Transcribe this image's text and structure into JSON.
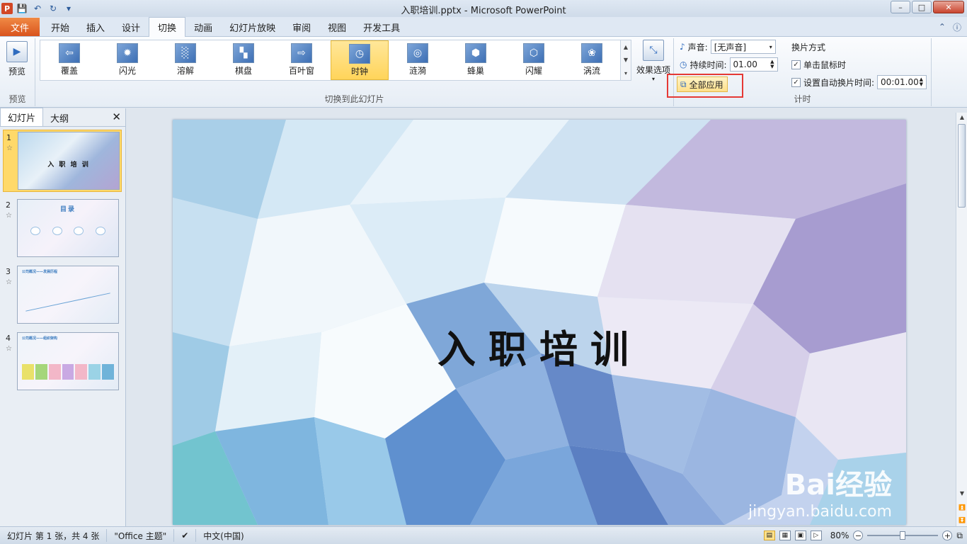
{
  "window": {
    "title": "入职培训.pptx - Microsoft PowerPoint",
    "app_icon": "P",
    "controls": [
      "minimize-icon",
      "maximize-icon",
      "close-icon"
    ]
  },
  "quick_access": [
    "save-icon",
    "undo-icon",
    "redo-icon",
    "customize-icon"
  ],
  "ribbon_tabs": {
    "file": "文件",
    "items": [
      "开始",
      "插入",
      "设计",
      "切换",
      "动画",
      "幻灯片放映",
      "审阅",
      "视图",
      "开发工具"
    ],
    "active": "切换"
  },
  "ribbon": {
    "preview": {
      "label": "预览",
      "group_label": "预览"
    },
    "transitions": [
      "覆盖",
      "闪光",
      "溶解",
      "棋盘",
      "百叶窗",
      "时钟",
      "涟漪",
      "蜂巢",
      "闪耀",
      "涡流"
    ],
    "selected_transition": "时钟",
    "group_label": "切换到此幻灯片",
    "effect_options": "效果选项",
    "timing": {
      "sound_label": "声音:",
      "sound_value": "[无声音]",
      "duration_label": "持续时间:",
      "duration_value": "01.00",
      "apply_all": "全部应用",
      "advance_title": "换片方式",
      "on_click_label": "单击鼠标时",
      "on_click_checked": true,
      "auto_after_label": "设置自动换片时间:",
      "auto_after_checked": true,
      "auto_after_value": "00:01.00",
      "group_label": "计时"
    }
  },
  "left_panel": {
    "tabs": [
      "幻灯片",
      "大纲"
    ],
    "active_tab": "幻灯片",
    "slides": [
      {
        "number": "1",
        "title": "入 职 培 训",
        "selected": true
      },
      {
        "number": "2",
        "title": "目录",
        "selected": false
      },
      {
        "number": "3",
        "title": "公司概况——发展历程",
        "selected": false
      },
      {
        "number": "4",
        "title": "公司概况——组织架构",
        "selected": false
      }
    ]
  },
  "slide": {
    "title": "入职培训"
  },
  "watermark": {
    "logo": "Bai经验",
    "url": "jingyan.baidu.com"
  },
  "status": {
    "slide_info": "幻灯片 第 1 张，共 4 张",
    "theme": "\"Office 主题\"",
    "language": "中文(中国)",
    "zoom": "80%"
  },
  "colors": {
    "file_tab": "#d9541d",
    "highlight_box": "#e53935",
    "selected_item": "#ffd96a"
  }
}
